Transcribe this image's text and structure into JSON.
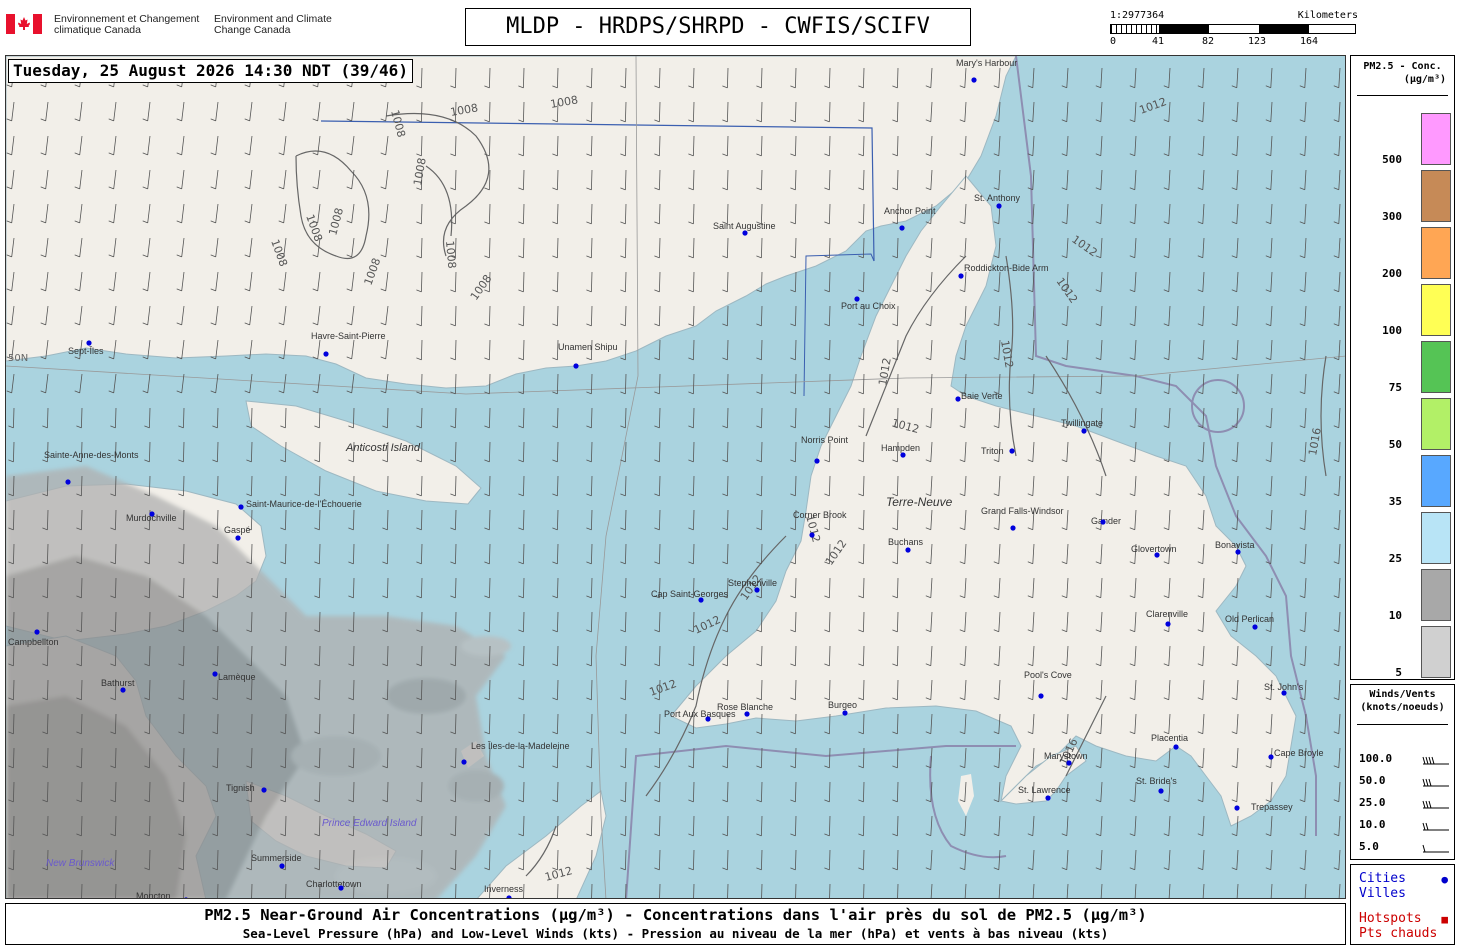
{
  "header": {
    "dept_fr": "Environnement et Changement climatique Canada",
    "dept_en": "Environment and Climate Change Canada",
    "title": "MLDP - HRDPS/SHRPD - CWFIS/SCIFV"
  },
  "scale": {
    "ratio": "1:2977364",
    "unit": "Kilometers",
    "ticks": [
      "0",
      "41",
      "82",
      "123",
      "164"
    ]
  },
  "timestamp": "Tuesday, 25 August 2026 14:30 NDT (39/46)",
  "map": {
    "colors": {
      "water": "#aad3df",
      "land": "#f2efe9",
      "smoke": "#9a9a9a",
      "isobar": "#666666",
      "city": "#0000dd"
    },
    "island_labels": [
      "Anticosti Island",
      "Terre-Neuve",
      "Prince Edward Island",
      "New Brunswick"
    ],
    "lat_label": "50N",
    "isobar_labels": [
      {
        "text": "1008"
      },
      {
        "text": "1008"
      },
      {
        "text": "1008"
      },
      {
        "text": "1008"
      },
      {
        "text": "1008"
      },
      {
        "text": "1008"
      },
      {
        "text": "1008"
      },
      {
        "text": "1008"
      },
      {
        "text": "1008"
      },
      {
        "text": "1008"
      },
      {
        "text": "1012"
      },
      {
        "text": "1012"
      },
      {
        "text": "1012"
      },
      {
        "text": "1012"
      },
      {
        "text": "1012"
      },
      {
        "text": "1012"
      },
      {
        "text": "1012"
      },
      {
        "text": "1012"
      },
      {
        "text": "1012"
      },
      {
        "text": "1012"
      },
      {
        "text": "1012"
      },
      {
        "text": "1012"
      },
      {
        "text": "1016"
      },
      {
        "text": "1016"
      }
    ],
    "cities": [
      "Mary's Harbour",
      "St. Anthony",
      "Anchor Point",
      "Roddickton-Bide Arm",
      "Saint Augustine",
      "Port au Choix",
      "Sept-Îles",
      "Havre-Saint-Pierre",
      "Unamen Shipu",
      "Baie Verte",
      "Twillingate",
      "Norris Point",
      "Hampden",
      "Triton",
      "Corner Brook",
      "Grand Falls-Windsor",
      "Gander",
      "Sainte-Anne-des-Monts",
      "Murdochville",
      "Saint-Maurice-de-l'Échouerie",
      "Gaspé",
      "Buchans",
      "Glovertown",
      "Bonavista",
      "Stephenville",
      "Cap Saint-Georges",
      "Clarenville",
      "Old Perlican",
      "Campbellton",
      "Bathurst",
      "Lamèque",
      "Port Aux Basques",
      "Rose Blanche",
      "Burgeo",
      "Pool's Cove",
      "St. John's",
      "Placentia",
      "Les Îles-de-la-Madeleine",
      "Marystown",
      "Cape Broyle",
      "St. Lawrence",
      "St. Bride's",
      "Trepassey",
      "Tignish",
      "Summerside",
      "Charlottetown",
      "Inverness",
      "Moncton"
    ]
  },
  "pm_legend": {
    "title_line1": "PM2.5 - Conc.",
    "title_line2": "(µg/m³)",
    "levels": [
      {
        "label": "500",
        "color": "#ff99ff"
      },
      {
        "label": "300",
        "color": "#c68a57"
      },
      {
        "label": "200",
        "color": "#ffa654"
      },
      {
        "label": "100",
        "color": "#ffff55"
      },
      {
        "label": "75",
        "color": "#55c455"
      },
      {
        "label": "50",
        "color": "#b2f067"
      },
      {
        "label": "35",
        "color": "#58a8ff"
      },
      {
        "label": "25",
        "color": "#b8e4f6"
      },
      {
        "label": "10",
        "color": "#a8a8a8"
      },
      {
        "label": "5",
        "color": "#d0d0d0"
      }
    ]
  },
  "wind_legend": {
    "title_line1": "Winds/Vents",
    "title_line2": "(knots/noeuds)",
    "rows": [
      "100.0",
      "50.0",
      "25.0",
      "10.0",
      "5.0"
    ]
  },
  "cities_legend": {
    "cities_en": "Cities",
    "cities_fr": "Villes",
    "hotspots_en": "Hotspots",
    "hotspots_fr": "Pts chauds",
    "city_color": "#0000dd",
    "hotspot_color": "#cc0000"
  },
  "footer": {
    "line1": "PM2.5 Near-Ground Air Concentrations (µg/m³) - Concentrations dans l'air près du sol de PM2.5 (µg/m³)",
    "line2": "Sea-Level Pressure (hPa) and Low-Level Winds (kts) - Pression au niveau de la mer (hPa) et vents à bas niveau (kts)"
  }
}
